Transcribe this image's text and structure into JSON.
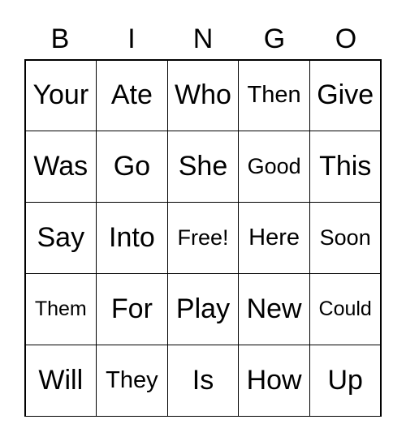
{
  "header": [
    "B",
    "I",
    "N",
    "G",
    "O"
  ],
  "cells": [
    [
      "Your",
      "Ate",
      "Who",
      "Then",
      "Give"
    ],
    [
      "Was",
      "Go",
      "She",
      "Good",
      "This"
    ],
    [
      "Say",
      "Into",
      "Free!",
      "Here",
      "Soon"
    ],
    [
      "Them",
      "For",
      "Play",
      "New",
      "Could"
    ],
    [
      "Will",
      "They",
      "Is",
      "How",
      "Up"
    ]
  ]
}
